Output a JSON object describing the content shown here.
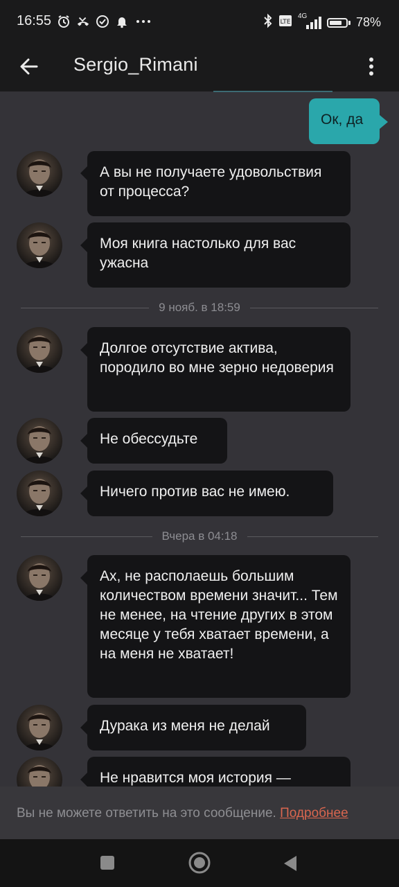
{
  "status_bar": {
    "time": "16:55",
    "notification_icons": [
      "alarm-icon",
      "missed-call-icon",
      "check-circle-icon",
      "bell-off-icon",
      "more-dots-icon"
    ],
    "right_icons": [
      "bluetooth-icon",
      "volte-icon",
      "signal-4g-icon"
    ],
    "network_label": "4G",
    "battery_percent": 78,
    "battery_label": "78%"
  },
  "header": {
    "title": "Sergio_Rimani",
    "back_icon": "arrow-left-icon",
    "menu_icon": "more-vertical-icon"
  },
  "outgoing_messages": [
    {
      "text": "Ок, да"
    }
  ],
  "separators": [
    {
      "label": "9 нояб. в 18:59"
    },
    {
      "label": "Вчера в 04:18"
    }
  ],
  "incoming_messages": [
    {
      "text": "А вы не получаете удовольствия от процесса?"
    },
    {
      "text": "Моя книга настолько для вас ужасна"
    },
    {
      "text": "Долгое отсутствие актива, породило во мне зерно недоверия"
    },
    {
      "text": "Не обессудьте"
    },
    {
      "text": "Ничего против вас не имею."
    },
    {
      "text": "Ах, не располаешь большим количеством времени значит... Тем не менее, на чтение других в этом месяце у тебя хватает времени, а на меня не хватает!"
    },
    {
      "text": "Дурака из меня не делай"
    },
    {
      "text": "Не нравится моя история —"
    }
  ],
  "notice": {
    "text": "Вы не можете ответить на это сообщение.",
    "link_text": "Подробнее"
  },
  "colors": {
    "background": "#343338",
    "bars": "#1a1a1b",
    "incoming_bubble": "#141416",
    "outgoing_bubble": "#2aa7ab",
    "link": "#d9664f"
  }
}
